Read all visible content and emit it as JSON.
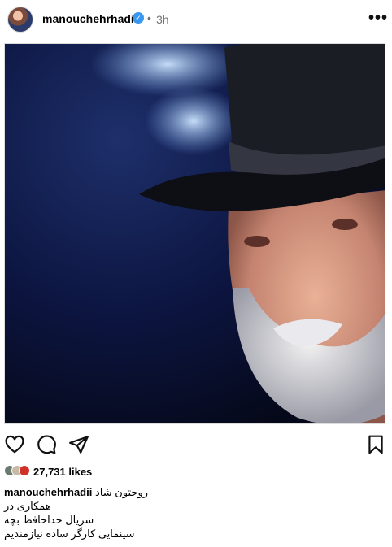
{
  "post": {
    "username": "manouchehrhadii",
    "verified_icon": "verified-badge-icon",
    "separator": "•",
    "time_ago": "3h",
    "more_icon": "more-options-icon",
    "more_label": "•••"
  },
  "photo": {
    "description_icon": "post-photo"
  },
  "actions": {
    "like_icon": "heart-icon",
    "comment_icon": "comment-icon",
    "share_icon": "share-icon",
    "save_icon": "bookmark-icon"
  },
  "likes": {
    "count_text": "27,731 likes"
  },
  "caption": {
    "username": "manouchehrhadii",
    "line1": "روحتون شاد",
    "line2": "همکاری در",
    "line3": "سریال خداحافظ بچه",
    "line4": "سینمایی کارگر ساده نیازمندیم"
  },
  "colors": {
    "verified": "#3897f0",
    "muted_text": "#737373",
    "photo_background": "#0b1233"
  }
}
